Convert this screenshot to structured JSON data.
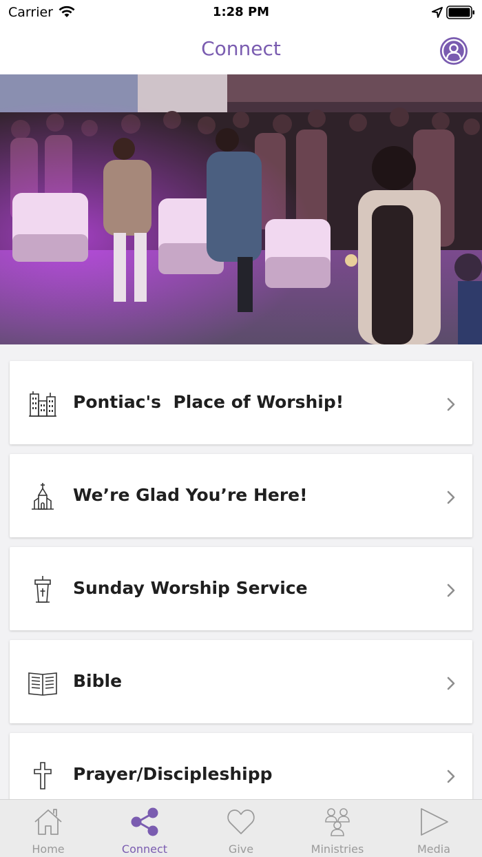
{
  "status_bar": {
    "carrier": "Carrier",
    "time": "1:28 PM"
  },
  "nav": {
    "title": "Connect"
  },
  "colors": {
    "accent": "#7a5cb0",
    "tab_inactive": "#9a9a9a"
  },
  "cards": [
    {
      "label": "Pontiac's  Place of Worship!",
      "icon": "buildings-icon"
    },
    {
      "label": "We’re Glad You’re Here!",
      "icon": "church-icon"
    },
    {
      "label": "Sunday Worship Service",
      "icon": "pulpit-icon"
    },
    {
      "label": "Bible",
      "icon": "bible-icon"
    },
    {
      "label": "Prayer/Discipleshipp",
      "icon": "cross-icon"
    }
  ],
  "tabs": [
    {
      "label": "Home",
      "icon": "home-icon",
      "active": false
    },
    {
      "label": "Connect",
      "icon": "share-icon",
      "active": true
    },
    {
      "label": "Give",
      "icon": "heart-icon",
      "active": false
    },
    {
      "label": "Ministries",
      "icon": "people-icon",
      "active": false
    },
    {
      "label": "Media",
      "icon": "play-icon",
      "active": false
    }
  ]
}
